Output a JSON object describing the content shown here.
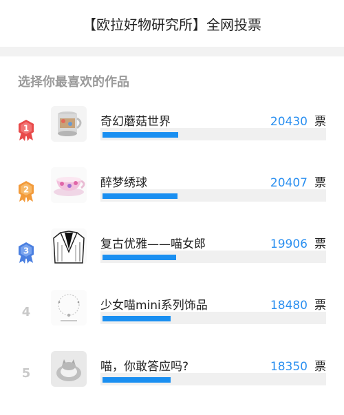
{
  "header": {
    "title": "【欧拉好物研究所】全网投票"
  },
  "section": {
    "title": "选择你最喜欢的作品"
  },
  "vote_unit": "票",
  "colors": {
    "accent": "#1a8ff1",
    "vote_number": "#2a8ff0",
    "rank1_badge": "#e84a4a",
    "rank2_badge": "#f29a3a",
    "rank3_badge": "#4a7fe0"
  },
  "items": [
    {
      "rank": "1",
      "name": "奇幻蘑菇世界",
      "votes": "20430",
      "share": 0.341,
      "badge_icon": "rank-1-medal-icon",
      "thumb_icon": "glass-cup-icon"
    },
    {
      "rank": "2",
      "name": "醉梦绣球",
      "votes": "20407",
      "share": 0.34,
      "badge_icon": "rank-2-medal-icon",
      "thumb_icon": "teacup-icon"
    },
    {
      "rank": "3",
      "name": "复古优雅——喵女郎",
      "votes": "19906",
      "share": 0.332,
      "badge_icon": "rank-3-medal-icon",
      "thumb_icon": "jacket-icon"
    },
    {
      "rank": "4",
      "name": "少女喵mini系列饰品",
      "votes": "18480",
      "share": 0.308,
      "badge_icon": "",
      "thumb_icon": "necklace-icon"
    },
    {
      "rank": "5",
      "name": "喵，你敢答应吗?",
      "votes": "18350",
      "share": 0.306,
      "badge_icon": "",
      "thumb_icon": "cat-ring-icon"
    }
  ]
}
